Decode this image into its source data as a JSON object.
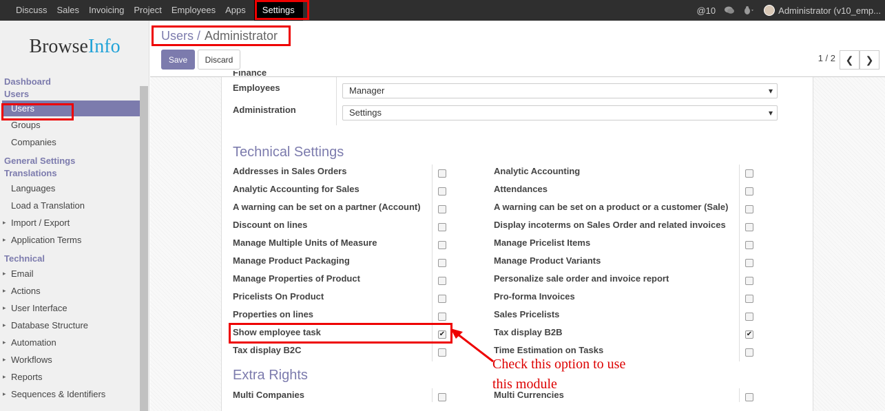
{
  "topbar": {
    "menu": [
      "Discuss",
      "Sales",
      "Invoicing",
      "Project",
      "Employees",
      "Apps"
    ],
    "active": "Settings",
    "messages": "@10",
    "user": "Administrator (v10_emp..."
  },
  "sidebar": {
    "logo_a": "Browse",
    "logo_b": "Info",
    "dashboard": "Dashboard",
    "users_head": "Users",
    "users": "Users",
    "groups": "Groups",
    "companies": "Companies",
    "general_settings": "General Settings",
    "translations": "Translations",
    "languages": "Languages",
    "load_translation": "Load a Translation",
    "import_export": "Import / Export",
    "app_terms": "Application Terms",
    "technical": "Technical",
    "email": "Email",
    "actions": "Actions",
    "user_interface": "User Interface",
    "db_structure": "Database Structure",
    "automation": "Automation",
    "workflows": "Workflows",
    "reports": "Reports",
    "sequences": "Sequences & Identifiers"
  },
  "control": {
    "crumb_parent": "Users /",
    "crumb_current": "Administrator",
    "save": "Save",
    "discard": "Discard",
    "pager": "1 / 2",
    "prev": "❮",
    "next": "❯"
  },
  "form": {
    "finance_partial": "Finance",
    "employees_label": "Employees",
    "employees_value": "Manager",
    "admin_label": "Administration",
    "admin_value": "Settings",
    "technical_title": "Technical Settings",
    "extra_title": "Extra Rights",
    "left": [
      {
        "label": "Addresses in Sales Orders",
        "checked": false
      },
      {
        "label": "Analytic Accounting for Sales",
        "checked": false
      },
      {
        "label": "A warning can be set on a partner (Account)",
        "checked": false
      },
      {
        "label": "Discount on lines",
        "checked": false
      },
      {
        "label": "Manage Multiple Units of Measure",
        "checked": false
      },
      {
        "label": "Manage Product Packaging",
        "checked": false
      },
      {
        "label": "Manage Properties of Product",
        "checked": false
      },
      {
        "label": "Pricelists On Product",
        "checked": false
      },
      {
        "label": "Properties on lines",
        "checked": false
      },
      {
        "label": "Show employee task",
        "checked": true
      },
      {
        "label": "Tax display B2C",
        "checked": false
      }
    ],
    "right": [
      {
        "label": "Analytic Accounting",
        "checked": false
      },
      {
        "label": "Attendances",
        "checked": false
      },
      {
        "label": "A warning can be set on a product or a customer (Sale)",
        "checked": false
      },
      {
        "label": "Display incoterms on Sales Order and related invoices",
        "checked": false
      },
      {
        "label": "Manage Pricelist Items",
        "checked": false
      },
      {
        "label": "Manage Product Variants",
        "checked": false
      },
      {
        "label": "Personalize sale order and invoice report",
        "checked": false
      },
      {
        "label": "Pro-forma Invoices",
        "checked": false
      },
      {
        "label": "Sales Pricelists",
        "checked": false
      },
      {
        "label": "Tax display B2B",
        "checked": true
      },
      {
        "label": "Time Estimation on Tasks",
        "checked": false
      }
    ],
    "extra_left": "Multi Companies",
    "extra_right": "Multi Currencies"
  },
  "annotation": {
    "line1": "Check this option to use",
    "line2": "this module"
  },
  "colors": {
    "accent": "#7c7bad",
    "highlight": "#ee0000"
  }
}
